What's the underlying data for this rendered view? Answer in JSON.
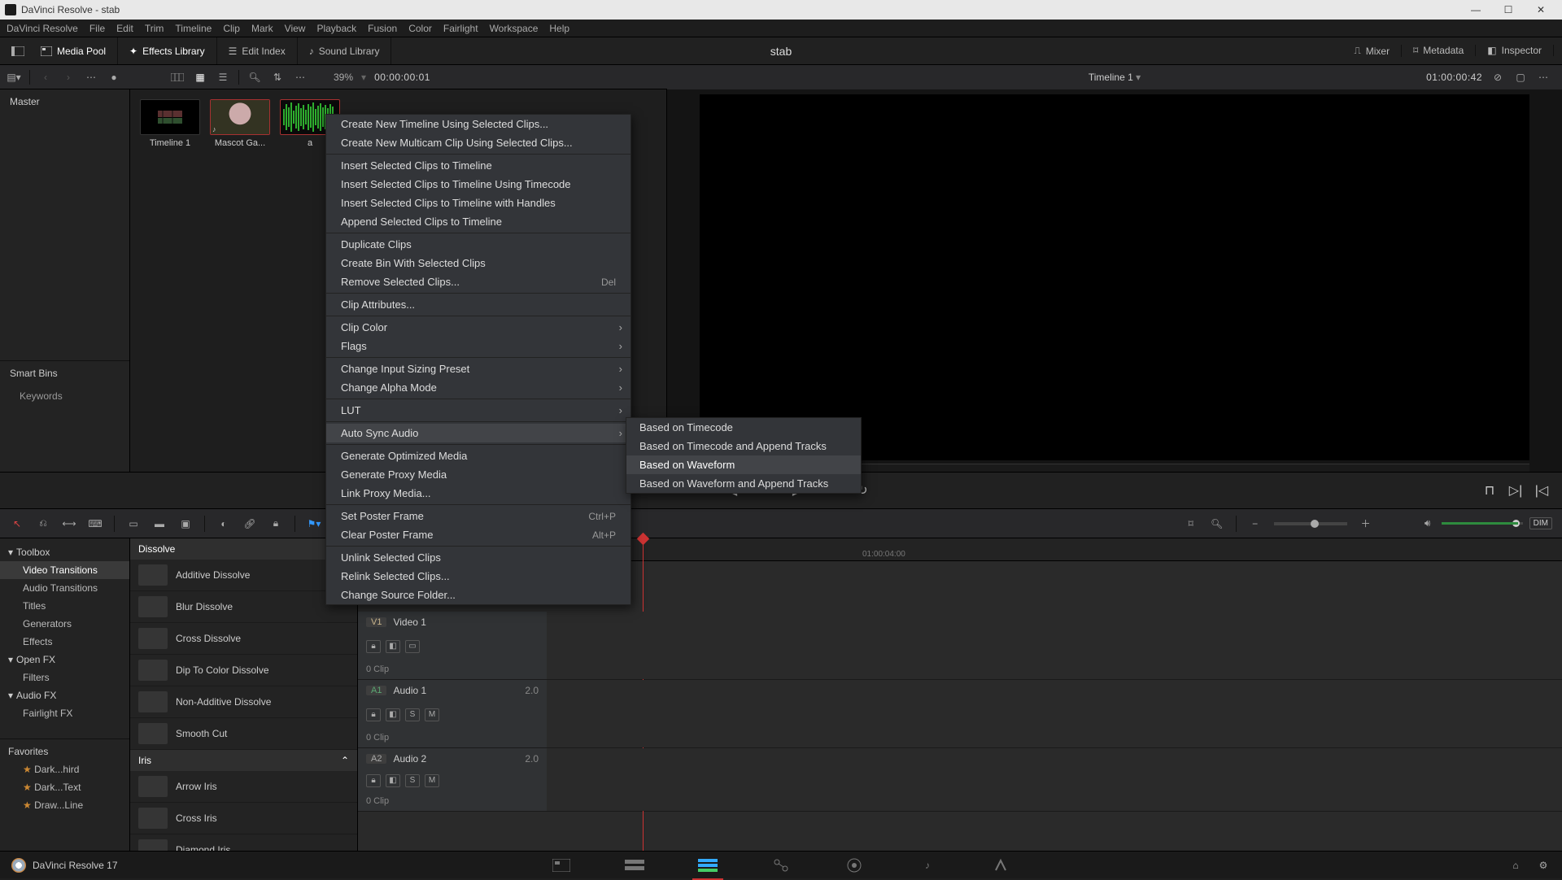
{
  "window": {
    "app_title": "DaVinci Resolve",
    "project": "stab"
  },
  "menubar": [
    "DaVinci Resolve",
    "File",
    "Edit",
    "Trim",
    "Timeline",
    "Clip",
    "Mark",
    "View",
    "Playback",
    "Fusion",
    "Color",
    "Fairlight",
    "Workspace",
    "Help"
  ],
  "workspace_tabs": {
    "left": [
      {
        "label": "Media Pool",
        "active": true
      },
      {
        "label": "Effects Library",
        "active": true
      },
      {
        "label": "Edit Index",
        "active": false
      },
      {
        "label": "Sound Library",
        "active": false
      }
    ],
    "center_title": "stab",
    "right": [
      {
        "label": "Mixer"
      },
      {
        "label": "Metadata"
      },
      {
        "label": "Inspector"
      }
    ]
  },
  "tool2": {
    "zoom": "39%",
    "timecode_left": "00:00:00:01"
  },
  "timeline_header": {
    "name": "Timeline 1",
    "timecode_right": "01:00:00:42"
  },
  "media_panel": {
    "master": "Master",
    "smart_bins": "Smart Bins",
    "keywords": "Keywords",
    "clips": [
      {
        "label": "Timeline 1",
        "kind": "timeline"
      },
      {
        "label": "Mascot Ga...",
        "kind": "video"
      },
      {
        "label": "a",
        "kind": "audio"
      }
    ]
  },
  "context_menu": {
    "groups": [
      [
        "Create New Timeline Using Selected Clips...",
        "Create New Multicam Clip Using Selected Clips..."
      ],
      [
        "Insert Selected Clips to Timeline",
        "Insert Selected Clips to Timeline Using Timecode",
        "Insert Selected Clips to Timeline with Handles",
        "Append Selected Clips to Timeline"
      ],
      [
        "Duplicate Clips",
        "Create Bin With Selected Clips",
        {
          "label": "Remove Selected Clips...",
          "shortcut": "Del"
        }
      ],
      [
        "Clip Attributes..."
      ],
      [
        {
          "label": "Clip Color",
          "arrow": true
        },
        {
          "label": "Flags",
          "arrow": true
        }
      ],
      [
        {
          "label": "Change Input Sizing Preset",
          "arrow": true
        },
        {
          "label": "Change Alpha Mode",
          "arrow": true
        }
      ],
      [
        {
          "label": "LUT",
          "arrow": true
        }
      ],
      [
        {
          "label": "Auto Sync Audio",
          "arrow": true,
          "hov": true
        }
      ],
      [
        "Generate Optimized Media",
        "Generate Proxy Media",
        "Link Proxy Media..."
      ],
      [
        {
          "label": "Set Poster Frame",
          "shortcut": "Ctrl+P"
        },
        {
          "label": "Clear Poster Frame",
          "shortcut": "Alt+P"
        }
      ],
      [
        "Unlink Selected Clips",
        "Relink Selected Clips...",
        "Change Source Folder..."
      ]
    ],
    "submenu": {
      "items": [
        "Based on Timecode",
        "Based on Timecode and Append Tracks",
        "Based on Waveform",
        "Based on Waveform and Append Tracks"
      ],
      "highlighted": 2
    }
  },
  "fx_tree": {
    "toolbox": "Toolbox",
    "items": [
      "Video Transitions",
      "Audio Transitions",
      "Titles",
      "Generators",
      "Effects"
    ],
    "active": 0,
    "openfx": "Open FX",
    "openfx_items": [
      "Filters"
    ],
    "audiofx": "Audio FX",
    "audiofx_items": [
      "Fairlight FX"
    ],
    "favorites": "Favorites",
    "favorites_items": [
      "Dark...hird",
      "Dark...Text",
      "Draw...Line"
    ]
  },
  "fx_list": {
    "sections": [
      {
        "title": "Dissolve",
        "items": [
          "Additive Dissolve",
          "Blur Dissolve",
          "Cross Dissolve",
          "Dip To Color Dissolve",
          "Non-Additive Dissolve",
          "Smooth Cut"
        ]
      },
      {
        "title": "Iris",
        "items": [
          "Arrow Iris",
          "Cross Iris",
          "Diamond Iris"
        ]
      }
    ]
  },
  "timeline_tracks": {
    "v1": {
      "chip": "V1",
      "name": "Video 1",
      "clips": "0 Clip"
    },
    "a1": {
      "chip": "A1",
      "name": "Audio 1",
      "ch": "2.0",
      "clips": "0 Clip"
    },
    "a2": {
      "chip": "A2",
      "name": "Audio 2",
      "ch": "2.0",
      "clips": "0 Clip"
    }
  },
  "ruler_mark": "01:00:04:00",
  "bottom": {
    "app": "DaVinci Resolve 17"
  },
  "dim_label": "DIM"
}
